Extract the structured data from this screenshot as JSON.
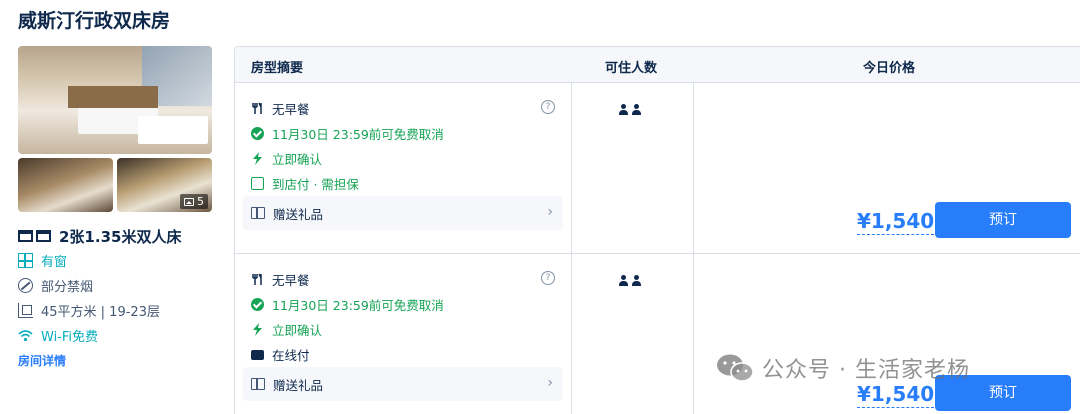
{
  "room": {
    "title": "威斯汀行政双床房",
    "photo_count": "5",
    "bed": "2张1.35米双人床",
    "features": {
      "window": "有窗",
      "smoking": "部分禁烟",
      "area_floor": "45平方米 | 19-23层",
      "wifi": "Wi-Fi免费"
    },
    "detail_link": "房间详情"
  },
  "table": {
    "headers": {
      "summary": "房型摘要",
      "occupancy": "可住人数",
      "price": "今日价格"
    },
    "rows": [
      {
        "meal": "无早餐",
        "cancel": "11月30日 23:59前可免费取消",
        "confirm": "立即确认",
        "payment": "到店付 · 需担保",
        "gift": "赠送礼品",
        "price": "¥1,540",
        "book": "预订"
      },
      {
        "meal": "无早餐",
        "cancel": "11月30日 23:59前可免费取消",
        "confirm": "立即确认",
        "payment": "在线付",
        "gift": "赠送礼品",
        "price": "¥1,540",
        "book": "预订"
      }
    ]
  },
  "watermark": "公众号 · 生活家老杨",
  "icons": [
    "image-icon",
    "bed-icon",
    "window-icon",
    "no-smoking-icon",
    "area-icon",
    "wifi-icon",
    "fork-knife-icon",
    "check-circle-icon",
    "lightning-icon",
    "card-icon",
    "help-icon",
    "gift-icon",
    "chevron-right-icon",
    "person-icon",
    "wechat-icon"
  ],
  "colors": {
    "brand_blue": "#287dfa",
    "green": "#15a355",
    "teal": "#06aebd",
    "text": "#0f294d"
  }
}
